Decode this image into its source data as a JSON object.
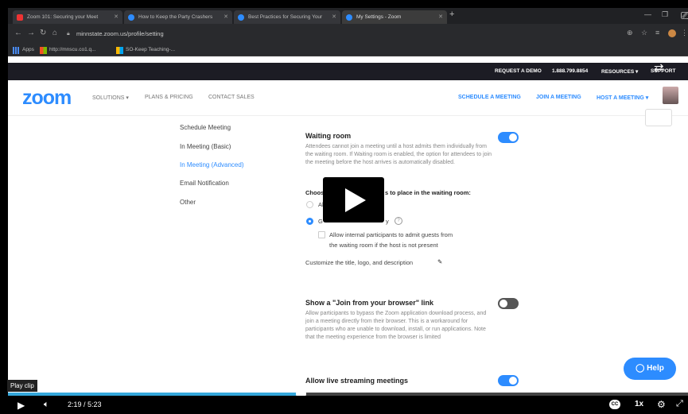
{
  "browser": {
    "tabs": [
      {
        "label": "Zoom 101: Securing your Meet"
      },
      {
        "label": "How to Keep the Party Crashers"
      },
      {
        "label": "Best Practices for Securing Your"
      },
      {
        "label": "My Settings - Zoom"
      }
    ],
    "url": "minnstate.zoom.us/profile/setting",
    "bookmarks": [
      {
        "label": "Apps"
      },
      {
        "label": "http://mnscu.co1.q..."
      },
      {
        "label": "SO-Keep Teaching-..."
      }
    ]
  },
  "zoom": {
    "topstrip": {
      "request_demo": "REQUEST A DEMO",
      "phone": "1.888.799.8854",
      "resources": "RESOURCES ▾",
      "support": "SUPPORT"
    },
    "logo": "zoom",
    "nav": {
      "solutions": "SOLUTIONS ▾",
      "plans": "PLANS & PRICING",
      "contact": "CONTACT SALES",
      "schedule": "SCHEDULE A MEETING",
      "join": "JOIN A MEETING",
      "host": "HOST A MEETING ▾"
    },
    "sidenav": [
      {
        "label": "Schedule Meeting",
        "active": false
      },
      {
        "label": "In Meeting (Basic)",
        "active": false
      },
      {
        "label": "In Meeting (Advanced)",
        "active": true
      },
      {
        "label": "Email Notification",
        "active": false
      },
      {
        "label": "Other",
        "active": false
      }
    ],
    "settings": {
      "waiting_room": {
        "title": "Waiting room",
        "desc": "Attendees cannot join a meeting until a host admits them individually from the waiting room. If Waiting room is enabled, the option for attendees to join the meeting before the host arrives is automatically disabled.",
        "enabled": true
      },
      "choose_label": "Choose which participants to place in the waiting room:",
      "choose_left": "Choos",
      "choose_right": "s to place in the waiting room:",
      "option_all": "Al",
      "option_guests": "G",
      "option_guests_tail": "y",
      "allow_internal": "Allow internal participants to admit guests from",
      "allow_internal_2": "the waiting room if the host is not present",
      "customize": "Customize the title, logo, and description",
      "join_browser": {
        "title": "Show a \"Join from your browser\" link",
        "desc": "Allow participants to bypass the Zoom application download process, and join a meeting directly from their browser. This is a workaround for participants who are unable to download, install, or run applications. Note that the meeting experience from the browser is limited",
        "enabled": false
      },
      "live_streaming": {
        "title": "Allow live streaming meetings",
        "enabled": true
      }
    },
    "help": "Help"
  },
  "player": {
    "tooltip": "Play clip",
    "current_time": "2:19",
    "duration": "/ 5:23",
    "progress_fraction": 0.43,
    "speed": "1x",
    "cc": "CC"
  }
}
